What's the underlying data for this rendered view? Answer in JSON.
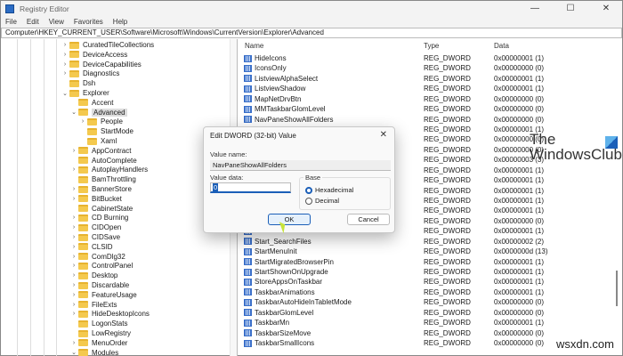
{
  "window": {
    "title": "Registry Editor",
    "controls": {
      "minimize": "—",
      "maximize": "☐",
      "close": "✕"
    }
  },
  "menu": [
    "File",
    "Edit",
    "View",
    "Favorites",
    "Help"
  ],
  "address": "Computer\\HKEY_CURRENT_USER\\Software\\Microsoft\\Windows\\CurrentVersion\\Explorer\\Advanced",
  "tree": [
    {
      "label": "CuratedTileCollections",
      "level": 0,
      "exp": ">"
    },
    {
      "label": "DeviceAccess",
      "level": 0,
      "exp": ">"
    },
    {
      "label": "DeviceCapabilities",
      "level": 0,
      "exp": ">"
    },
    {
      "label": "Diagnostics",
      "level": 0,
      "exp": ">"
    },
    {
      "label": "Dsh",
      "level": 0,
      "exp": ""
    },
    {
      "label": "Explorer",
      "level": 0,
      "exp": "v"
    },
    {
      "label": "Accent",
      "level": 1,
      "exp": ""
    },
    {
      "label": "Advanced",
      "level": 1,
      "exp": "v",
      "selected": true
    },
    {
      "label": "People",
      "level": 2,
      "exp": ">"
    },
    {
      "label": "StartMode",
      "level": 2,
      "exp": ""
    },
    {
      "label": "Xaml",
      "level": 2,
      "exp": ""
    },
    {
      "label": "AppContract",
      "level": 1,
      "exp": ">"
    },
    {
      "label": "AutoComplete",
      "level": 1,
      "exp": ""
    },
    {
      "label": "AutoplayHandlers",
      "level": 1,
      "exp": ">"
    },
    {
      "label": "BamThrottling",
      "level": 1,
      "exp": ""
    },
    {
      "label": "BannerStore",
      "level": 1,
      "exp": ">"
    },
    {
      "label": "BitBucket",
      "level": 1,
      "exp": ">"
    },
    {
      "label": "CabinetState",
      "level": 1,
      "exp": ""
    },
    {
      "label": "CD Burning",
      "level": 1,
      "exp": ">"
    },
    {
      "label": "CIDOpen",
      "level": 1,
      "exp": ">"
    },
    {
      "label": "CIDSave",
      "level": 1,
      "exp": ">"
    },
    {
      "label": "CLSID",
      "level": 1,
      "exp": ">"
    },
    {
      "label": "ComDlg32",
      "level": 1,
      "exp": ">"
    },
    {
      "label": "ControlPanel",
      "level": 1,
      "exp": ">"
    },
    {
      "label": "Desktop",
      "level": 1,
      "exp": ">"
    },
    {
      "label": "Discardable",
      "level": 1,
      "exp": ">"
    },
    {
      "label": "FeatureUsage",
      "level": 1,
      "exp": ">"
    },
    {
      "label": "FileExts",
      "level": 1,
      "exp": ">"
    },
    {
      "label": "HideDesktopIcons",
      "level": 1,
      "exp": ">"
    },
    {
      "label": "LogonStats",
      "level": 1,
      "exp": ""
    },
    {
      "label": "LowRegistry",
      "level": 1,
      "exp": ""
    },
    {
      "label": "MenuOrder",
      "level": 1,
      "exp": ">"
    },
    {
      "label": "Modules",
      "level": 1,
      "exp": "v"
    }
  ],
  "list": {
    "headers": {
      "name": "Name",
      "type": "Type",
      "data": "Data"
    },
    "rows": [
      {
        "name": "HideIcons",
        "type": "REG_DWORD",
        "data": "0x00000001 (1)"
      },
      {
        "name": "IconsOnly",
        "type": "REG_DWORD",
        "data": "0x00000000 (0)"
      },
      {
        "name": "ListviewAlphaSelect",
        "type": "REG_DWORD",
        "data": "0x00000001 (1)"
      },
      {
        "name": "ListviewShadow",
        "type": "REG_DWORD",
        "data": "0x00000001 (1)"
      },
      {
        "name": "MapNetDrvBtn",
        "type": "REG_DWORD",
        "data": "0x00000000 (0)"
      },
      {
        "name": "MMTaskbarGlomLevel",
        "type": "REG_DWORD",
        "data": "0x00000000 (0)"
      },
      {
        "name": "NavPaneShowAllFolders",
        "type": "REG_DWORD",
        "data": "0x00000000 (0)"
      },
      {
        "name": "",
        "type": "REG_DWORD",
        "data": "0x00000001 (1)"
      },
      {
        "name": "",
        "type": "REG_DWORD",
        "data": "0x00000000 (0)"
      },
      {
        "name": "",
        "type": "REG_DWORD",
        "data": "0x00000000 (0)"
      },
      {
        "name": "",
        "type": "REG_DWORD",
        "data": "0x00000003 (3)"
      },
      {
        "name": "",
        "type": "REG_DWORD",
        "data": "0x00000001 (1)"
      },
      {
        "name": "",
        "type": "REG_DWORD",
        "data": "0x00000001 (1)"
      },
      {
        "name": "",
        "type": "REG_DWORD",
        "data": "0x00000001 (1)"
      },
      {
        "name": "",
        "type": "REG_DWORD",
        "data": "0x00000001 (1)"
      },
      {
        "name": "",
        "type": "REG_DWORD",
        "data": "0x00000001 (1)"
      },
      {
        "name": "",
        "type": "REG_DWORD",
        "data": "0x00000000 (0)"
      },
      {
        "name": "",
        "type": "REG_DWORD",
        "data": "0x00000001 (1)"
      },
      {
        "name": "Start_SearchFiles",
        "type": "REG_DWORD",
        "data": "0x00000002 (2)"
      },
      {
        "name": "StartMenuInit",
        "type": "REG_DWORD",
        "data": "0x0000000d (13)"
      },
      {
        "name": "StartMigratedBrowserPin",
        "type": "REG_DWORD",
        "data": "0x00000001 (1)"
      },
      {
        "name": "StartShownOnUpgrade",
        "type": "REG_DWORD",
        "data": "0x00000001 (1)"
      },
      {
        "name": "StoreAppsOnTaskbar",
        "type": "REG_DWORD",
        "data": "0x00000001 (1)"
      },
      {
        "name": "TaskbarAnimations",
        "type": "REG_DWORD",
        "data": "0x00000001 (1)"
      },
      {
        "name": "TaskbarAutoHideInTabletMode",
        "type": "REG_DWORD",
        "data": "0x00000000 (0)"
      },
      {
        "name": "TaskbarGlomLevel",
        "type": "REG_DWORD",
        "data": "0x00000000 (0)"
      },
      {
        "name": "TaskbarMn",
        "type": "REG_DWORD",
        "data": "0x00000001 (1)"
      },
      {
        "name": "TaskbarSizeMove",
        "type": "REG_DWORD",
        "data": "0x00000000 (0)"
      },
      {
        "name": "TaskbarSmallIcons",
        "type": "REG_DWORD",
        "data": "0x00000000 (0)"
      }
    ]
  },
  "dialog": {
    "title": "Edit DWORD (32-bit) Value",
    "close": "✕",
    "value_name_label": "Value name:",
    "value_name": "NavPaneShowAllFolders",
    "value_data_label": "Value data:",
    "value_data": "0",
    "base_label": "Base",
    "hex_label": "Hexadecimal",
    "dec_label": "Decimal",
    "selected_base": "Hexadecimal",
    "ok": "OK",
    "cancel": "Cancel"
  },
  "watermarks": {
    "brand_line1": "The",
    "brand_line2": "WindowsClub",
    "site": "wsxdn.com"
  }
}
